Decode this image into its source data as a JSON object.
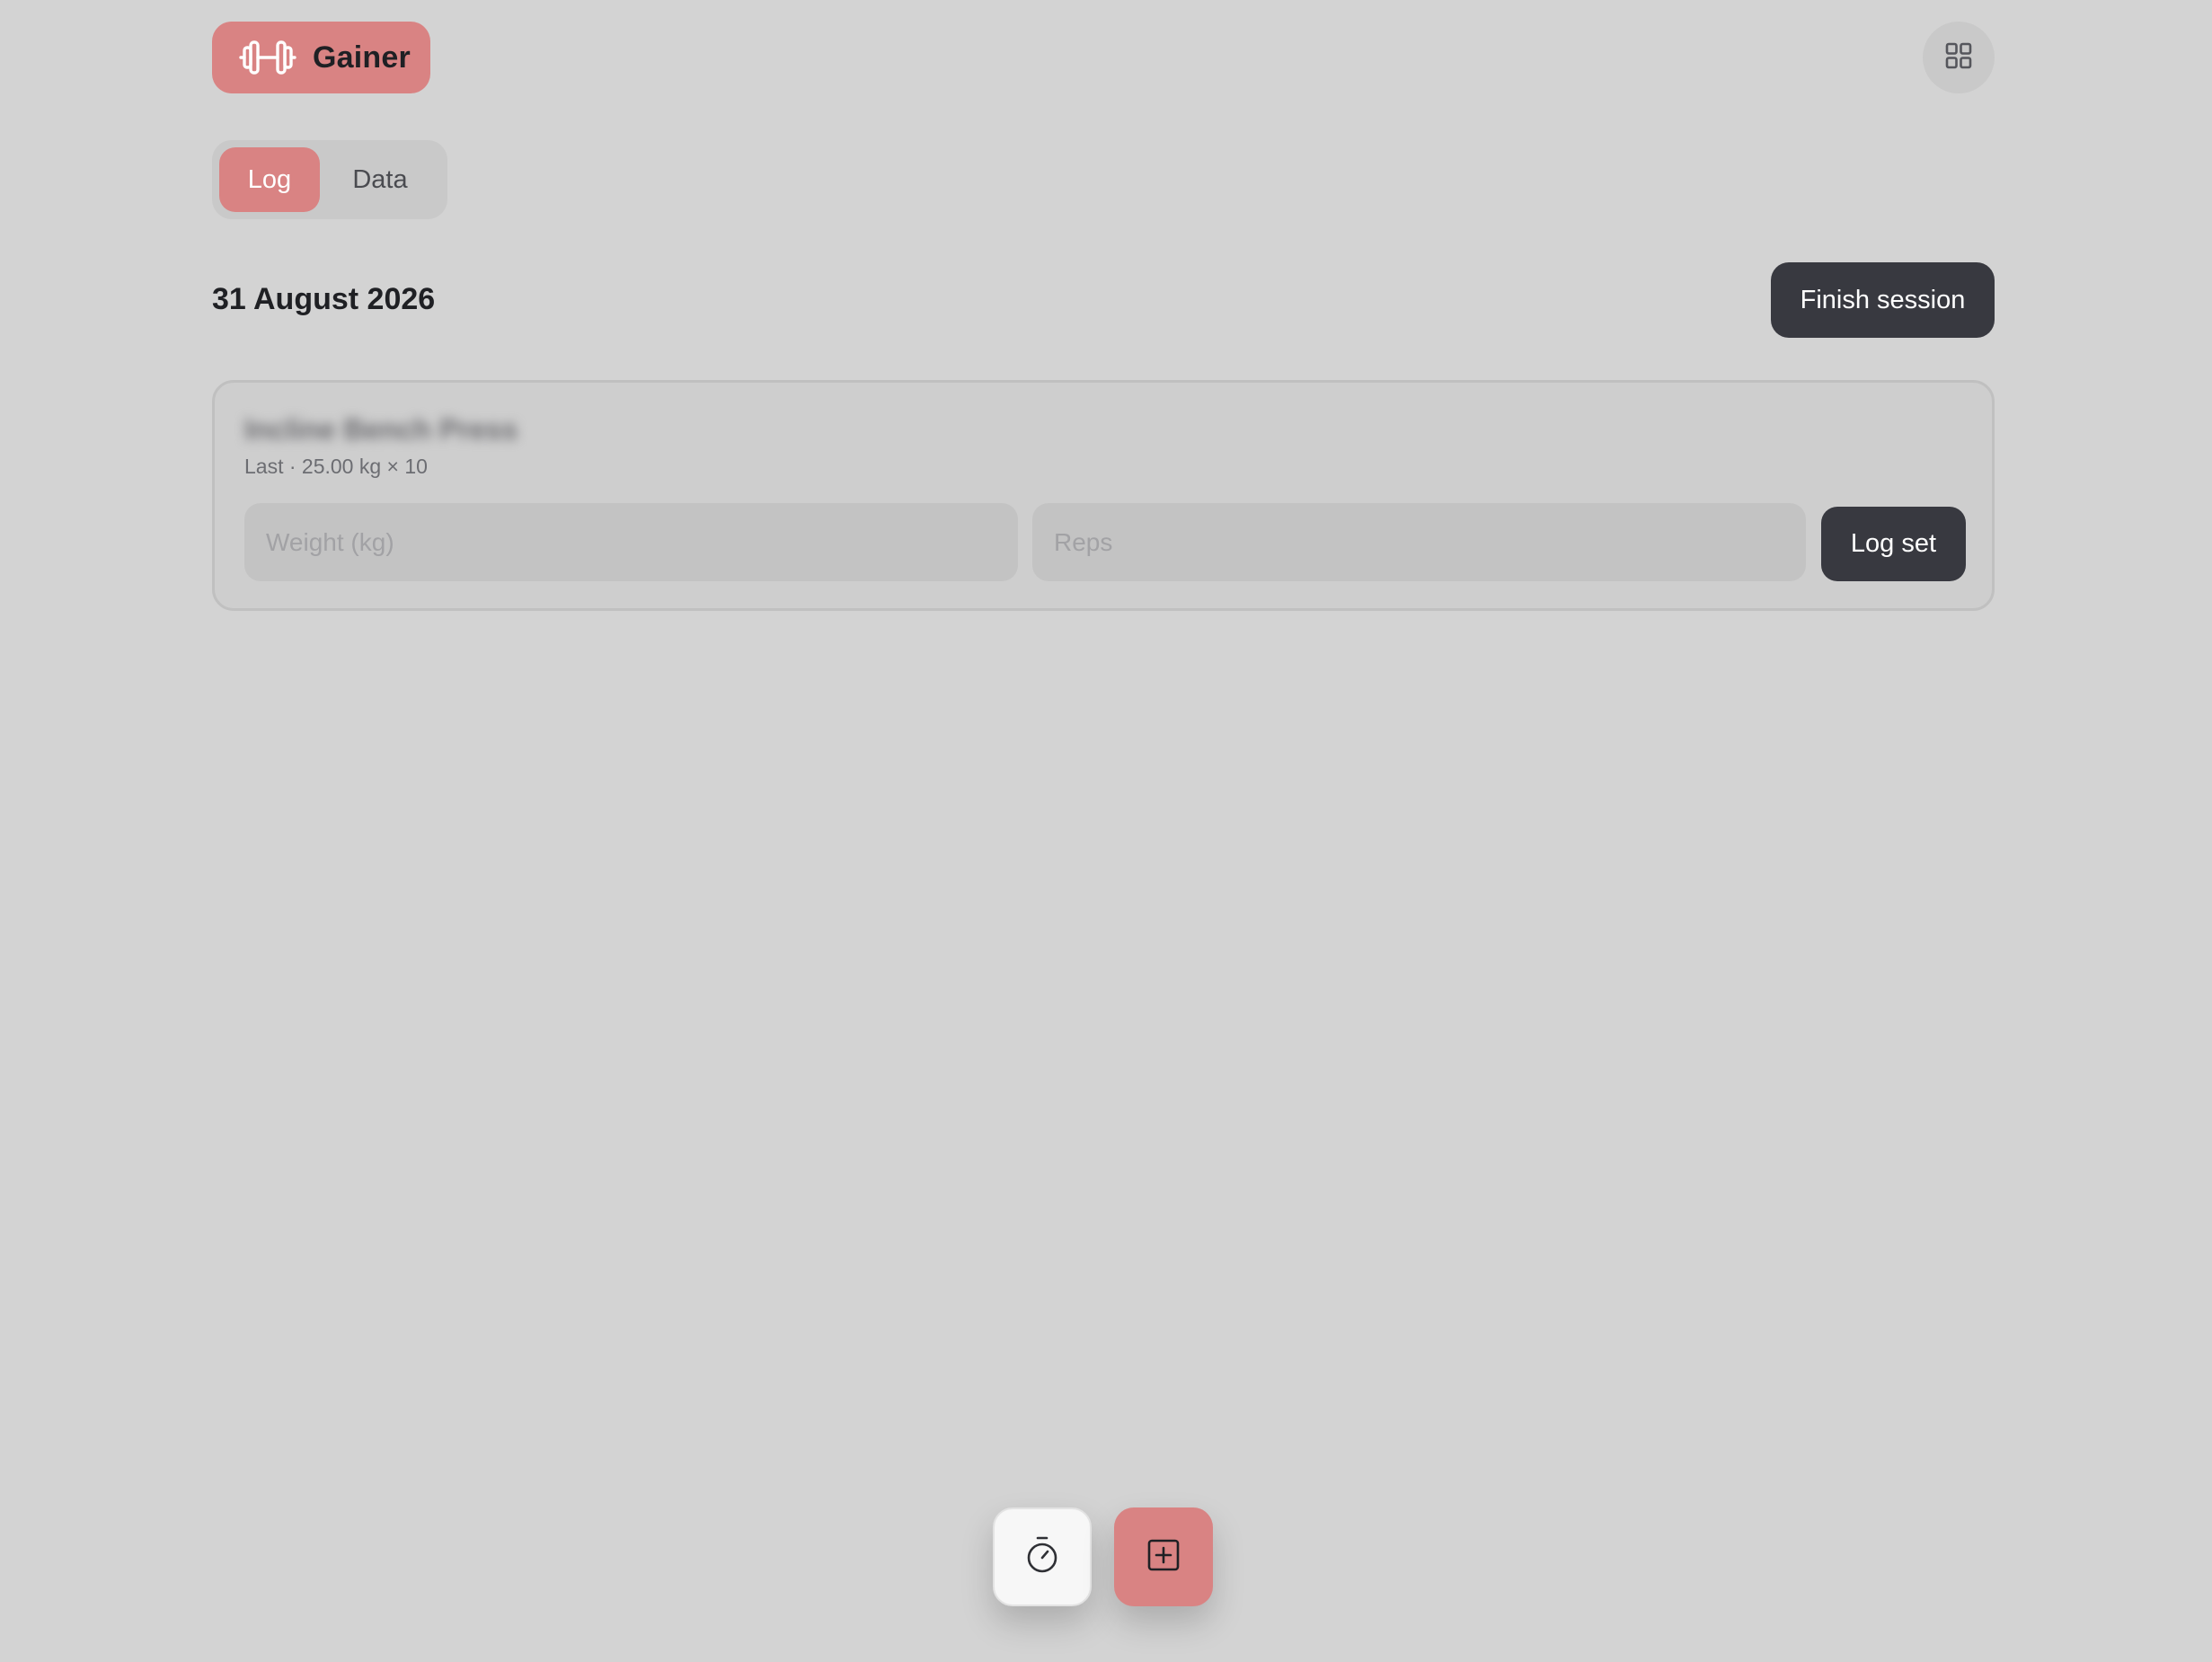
{
  "app": {
    "name": "Gainer",
    "accent_color": "#d98383",
    "icons": {
      "brand": "dumbbell-icon",
      "menu": "grid-icon",
      "timer": "stopwatch-icon",
      "add": "plus-square-icon"
    }
  },
  "tabs": {
    "log_label": "Log",
    "data_label": "Data",
    "active": "Log"
  },
  "session": {
    "date": "31 August 2026",
    "finish_label": "Finish session"
  },
  "exercise": {
    "name": "Incline Bench Press",
    "last_info": "Last · 25.00 kg × 10",
    "weight_placeholder": "Weight (kg)",
    "reps_placeholder": "Reps",
    "log_set_label": "Log set"
  }
}
